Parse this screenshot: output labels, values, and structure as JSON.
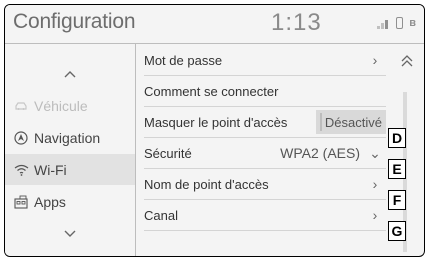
{
  "header": {
    "title": "Configuration",
    "time": "1:13",
    "status_icons": [
      "signal-icon",
      "phone-icon",
      "bluetooth-icon"
    ]
  },
  "sidebar": {
    "up_icon": "chevron-up-icon",
    "down_icon": "chevron-down-icon",
    "items": [
      {
        "label": "Véhicule",
        "icon": "car-icon",
        "enabled": false
      },
      {
        "label": "Navigation",
        "icon": "navigation-icon",
        "enabled": true
      },
      {
        "label": "Wi-Fi",
        "icon": "wifi-icon",
        "enabled": true,
        "selected": true
      },
      {
        "label": "Apps",
        "icon": "apps-icon",
        "enabled": true
      }
    ]
  },
  "list": {
    "rows": [
      {
        "label": "Mot de passe",
        "chevron": "›"
      },
      {
        "label": "Comment se connecter"
      },
      {
        "label": "Masquer le point d'accès",
        "toggle": "Désactivé"
      },
      {
        "label": "Sécurité",
        "value": "WPA2 (AES)",
        "chevron": "⌄"
      },
      {
        "label": "Nom de point d'accès",
        "chevron": "›"
      },
      {
        "label": "Canal",
        "chevron": "›"
      }
    ]
  },
  "scroll": {
    "up_icon": "double-chevron-up-icon"
  },
  "callouts": [
    "D",
    "E",
    "F",
    "G"
  ],
  "colors": {
    "background": "#f4f4f4",
    "selected": "#e2e2e2",
    "disabled": "#bcbcbc",
    "divider": "#bdbdbd"
  }
}
